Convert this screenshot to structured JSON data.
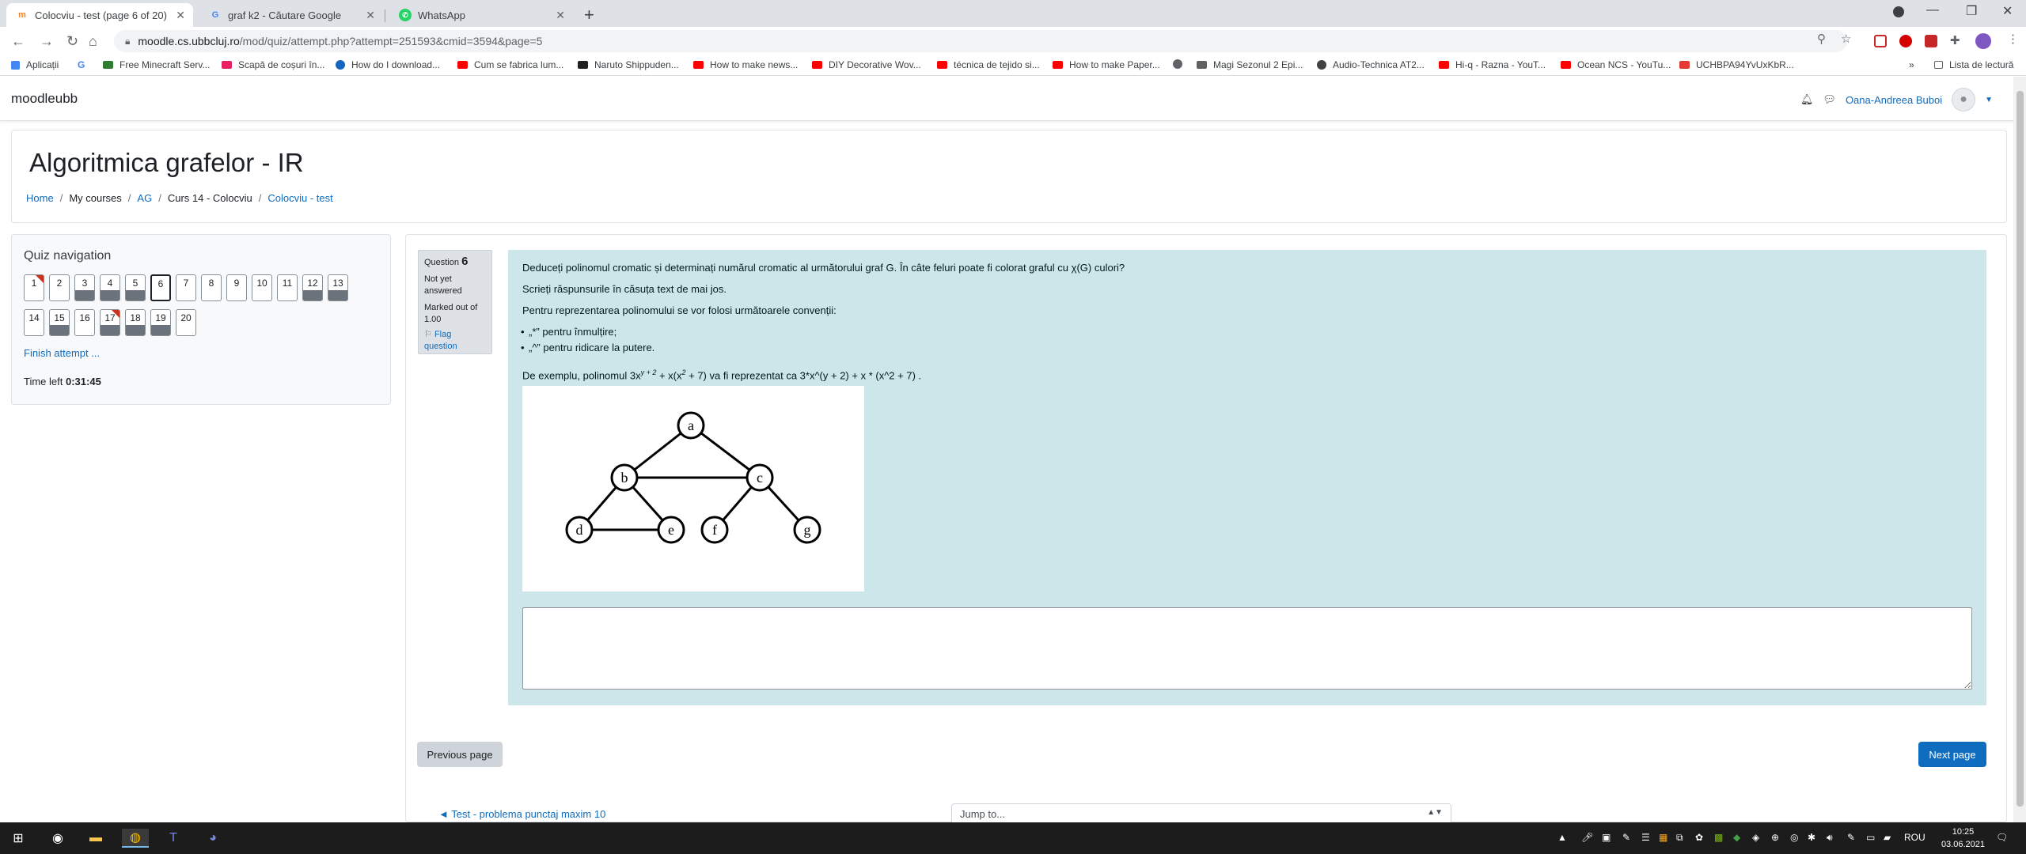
{
  "browser": {
    "tabs": [
      {
        "title": "Colocviu - test (page 6 of 20)",
        "favicon": "moodle-icon",
        "active": true
      },
      {
        "title": "graf k2 - Căutare Google",
        "favicon": "google-icon",
        "active": false
      },
      {
        "title": "WhatsApp",
        "favicon": "whatsapp-icon",
        "active": false
      }
    ],
    "url_host": "moodle.cs.ubbcluj.ro",
    "url_path": "/mod/quiz/attempt.php?attempt=251593&cmid=3594&page=5",
    "bookmarks": [
      "Aplicații",
      "Free Minecraft Serv...",
      "Scapă de coșuri în...",
      "How do I download...",
      "Cum se fabrica lum...",
      "Naruto Shippuden...",
      "How to make news...",
      "DIY Decorative Wov...",
      "técnica de tejido si...",
      "How to make Paper...",
      "Magi Sezonul 2 Epi...",
      "Audio-Technica AT2...",
      "Hi-q - Razna - YouT...",
      "Ocean NCS - YouTu...",
      "UCHBPA94YvUxKbR..."
    ],
    "reading_list": "Lista de lectură"
  },
  "site": {
    "brand": "moodleubb",
    "user_name": "Oana-Andreea Buboi"
  },
  "header": {
    "title": "Algoritmica grafelor - IR",
    "breadcrumbs": [
      "Home",
      "My courses",
      "AG",
      "Curs 14 - Colocviu",
      "Colocviu - test"
    ]
  },
  "quiz_nav": {
    "title": "Quiz navigation",
    "finish": "Finish attempt ...",
    "time_left_label": "Time left",
    "time_left": "0:31:45"
  },
  "question": {
    "label": "Question",
    "number": "6",
    "state": "Not yet answered",
    "marked": "Marked out of 1.00",
    "flag": "Flag question",
    "text1": "Deduceți polinomul cromatic și determinați numărul cromatic al următorului graf G. În câte feluri poate fi colorat graful cu χ(G) culori?",
    "text2": "Scrieți răspunsurile în căsuța text de mai jos.",
    "text3": "Pentru reprezentarea polinomului se vor folosi următoarele convenții:",
    "bullet1": "„*” pentru înmulțire;",
    "bullet2": "„^” pentru ridicare la putere.",
    "example_a": "De exemplu, polinomul 3x",
    "example_sup": "y + 2",
    "example_b": " + x(x",
    "example_sup2": "2",
    "example_c": " + 7) va fi reprezentat ca 3*x^(y + 2) + x * (x^2 + 7) .",
    "graph_nodes": [
      "a",
      "b",
      "c",
      "d",
      "e",
      "f",
      "g"
    ]
  },
  "buttons": {
    "previous": "Previous page",
    "next": "Next page"
  },
  "footer": {
    "link": "◄ Test - problema punctaj maxim 10",
    "jump": "Jump to..."
  },
  "taskbar": {
    "lang": "ROU",
    "time": "10:25",
    "date": "03.06.2021"
  }
}
